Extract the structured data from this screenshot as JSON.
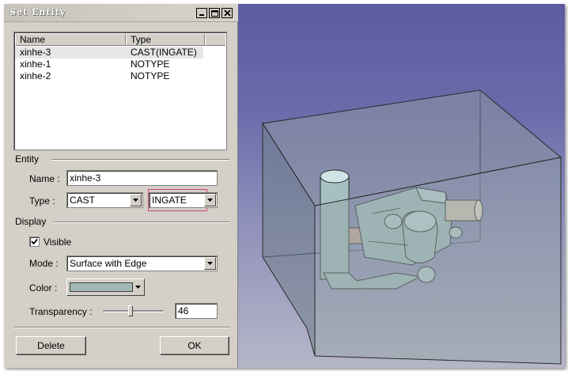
{
  "window": {
    "title": "Set Entity"
  },
  "list": {
    "columns": [
      "Name",
      "Type"
    ],
    "rows": [
      {
        "name": "xinhe-3",
        "type": "CAST(INGATE)",
        "selected": true
      },
      {
        "name": "xinhe-1",
        "type": "NOTYPE",
        "selected": false
      },
      {
        "name": "xinhe-2",
        "type": "NOTYPE",
        "selected": false
      }
    ]
  },
  "entity": {
    "group_label": "Entity",
    "name_label": "Name :",
    "name_value": "xinhe-3",
    "type_label": "Type :",
    "type_value": "CAST",
    "subtype_value": "INGATE"
  },
  "display": {
    "group_label": "Display",
    "visible_label": "Visible",
    "visible_checked": true,
    "mode_label": "Mode :",
    "mode_value": "Surface with Edge",
    "color_label": "Color :",
    "color_value": "#9fb8b4",
    "transparency_label": "Transparency :",
    "transparency_value": "46",
    "transparency_fraction": 0.46
  },
  "buttons": {
    "delete": "Delete",
    "ok": "OK"
  },
  "icons": [
    "minimize-icon",
    "maximize-icon",
    "close-icon",
    "dropdown-arrow-icon",
    "checkmark-icon"
  ],
  "colors": {
    "dialog_bg": "#d4d0c8",
    "viewport_top": "#5e5aa0",
    "part_color": "#a9c4c4"
  }
}
